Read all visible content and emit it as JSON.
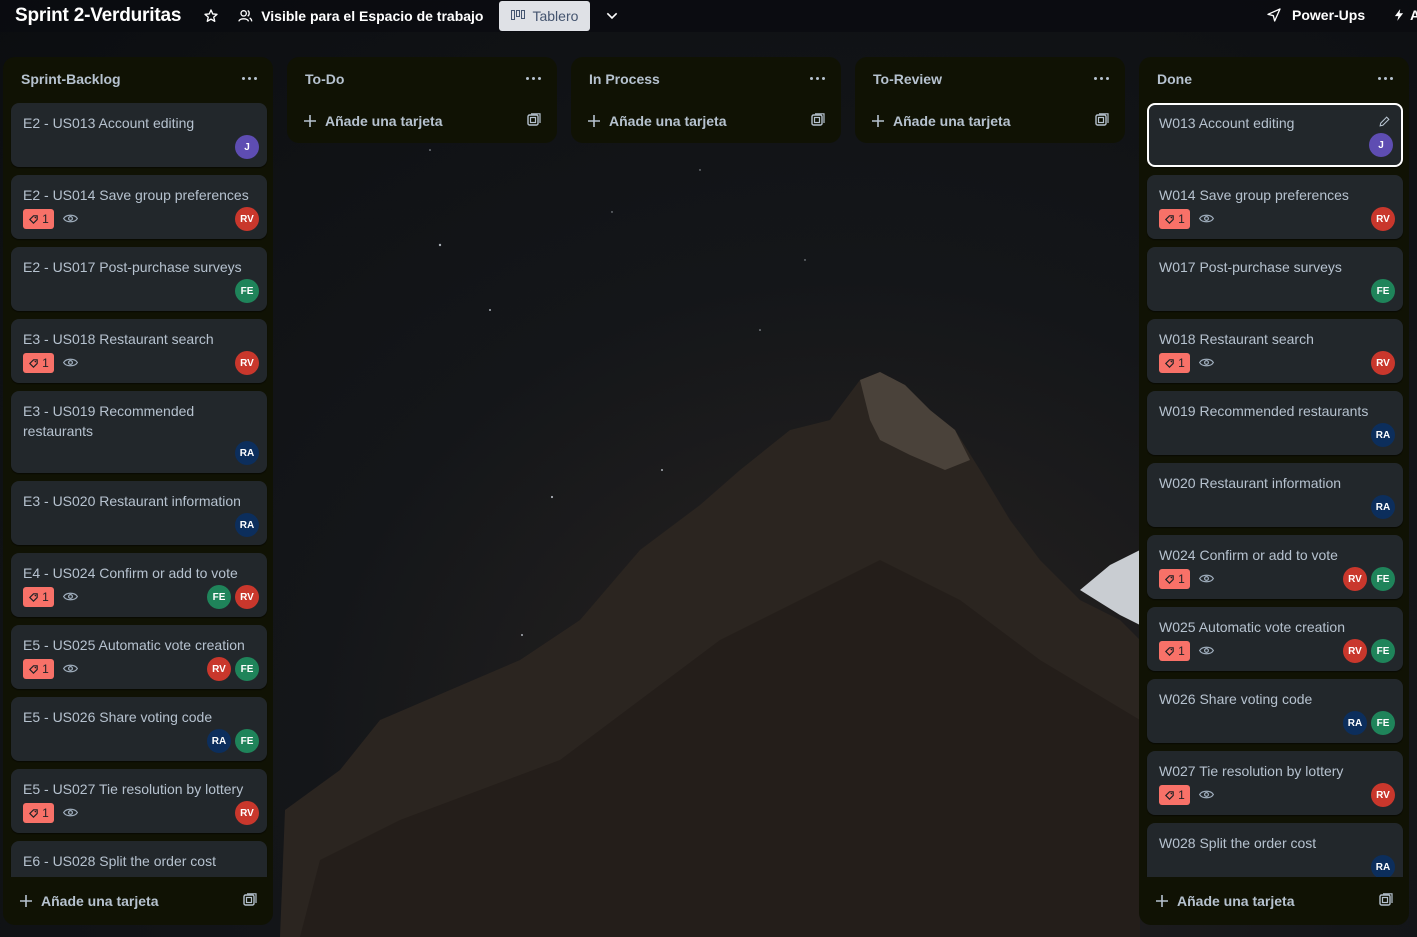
{
  "header": {
    "board_title": "Sprint 2-Verduritas",
    "visibility_label": "Visible para el Espacio de trabajo",
    "view_label": "Tablero",
    "powerups_label": "Power-Ups"
  },
  "add_card_label": "Añade una tarjeta",
  "colors": {
    "list_bg": "#101204",
    "card_bg": "#22272b",
    "text": "#b6c2cf",
    "bug_badge": "#f87168",
    "avatar_J": "#5e4db2",
    "avatar_RV": "#c9372c",
    "avatar_FE": "#1f845a",
    "avatar_RA": "#0c2e5c"
  },
  "icons": {
    "star": "star-icon",
    "visibility": "people-icon",
    "board": "board-icon",
    "chevron": "chevron-down-icon",
    "powerups": "rocket-icon",
    "automation": "lightning-icon",
    "list_menu": "more-horizontal-icon",
    "add": "plus-icon",
    "template": "template-icon",
    "bug": "bug-icon",
    "watch": "eye-icon",
    "edit": "pencil-icon"
  },
  "lists": [
    {
      "title": "Sprint-Backlog",
      "cards": [
        {
          "title": "E2 - US013 Account editing",
          "badge": null,
          "watch": false,
          "avatars": [
            "J"
          ]
        },
        {
          "title": "E2 - US014 Save group preferences",
          "badge": "1",
          "watch": true,
          "avatars": [
            "RV"
          ]
        },
        {
          "title": "E2 - US017 Post-purchase surveys",
          "badge": null,
          "watch": false,
          "avatars": [
            "FE"
          ]
        },
        {
          "title": "E3 - US018 Restaurant search",
          "badge": "1",
          "watch": true,
          "avatars": [
            "RV"
          ]
        },
        {
          "title": "E3 - US019 Recommended restaurants",
          "badge": null,
          "watch": false,
          "avatars": [
            "RA"
          ]
        },
        {
          "title": "E3 - US020 Restaurant information",
          "badge": null,
          "watch": false,
          "avatars": [
            "RA"
          ]
        },
        {
          "title": "E4 - US024 Confirm or add to vote",
          "badge": "1",
          "watch": true,
          "avatars": [
            "FE",
            "RV"
          ]
        },
        {
          "title": "E5 - US025 Automatic vote creation",
          "badge": "1",
          "watch": true,
          "avatars": [
            "RV",
            "FE"
          ]
        },
        {
          "title": "E5 - US026 Share voting code",
          "badge": null,
          "watch": false,
          "avatars": [
            "RA",
            "FE"
          ]
        },
        {
          "title": "E5 - US027 Tie resolution by lottery",
          "badge": "1",
          "watch": true,
          "avatars": [
            "RV"
          ]
        },
        {
          "title": "E6 - US028 Split the order cost",
          "badge": null,
          "watch": false,
          "avatars": []
        }
      ]
    },
    {
      "title": "To-Do",
      "cards": []
    },
    {
      "title": "In Process",
      "cards": []
    },
    {
      "title": "To-Review",
      "cards": []
    },
    {
      "title": "Done",
      "cards": [
        {
          "title": "W013 Account editing",
          "badge": null,
          "watch": false,
          "avatars": [
            "J"
          ],
          "focused": true
        },
        {
          "title": "W014 Save group preferences",
          "badge": "1",
          "watch": true,
          "avatars": [
            "RV"
          ]
        },
        {
          "title": "W017 Post-purchase surveys",
          "badge": null,
          "watch": false,
          "avatars": [
            "FE"
          ]
        },
        {
          "title": "W018 Restaurant search",
          "badge": "1",
          "watch": true,
          "avatars": [
            "RV"
          ]
        },
        {
          "title": "W019 Recommended restaurants",
          "badge": null,
          "watch": false,
          "avatars": [
            "RA"
          ]
        },
        {
          "title": "W020 Restaurant information",
          "badge": null,
          "watch": false,
          "avatars": [
            "RA"
          ]
        },
        {
          "title": "W024 Confirm or add to vote",
          "badge": "1",
          "watch": true,
          "avatars": [
            "RV",
            "FE"
          ]
        },
        {
          "title": "W025 Automatic vote creation",
          "badge": "1",
          "watch": true,
          "avatars": [
            "RV",
            "FE"
          ]
        },
        {
          "title": "W026 Share voting code",
          "badge": null,
          "watch": false,
          "avatars": [
            "RA",
            "FE"
          ]
        },
        {
          "title": "W027 Tie resolution by lottery",
          "badge": "1",
          "watch": true,
          "avatars": [
            "RV"
          ]
        },
        {
          "title": "W028 Split the order cost",
          "badge": null,
          "watch": false,
          "avatars": [
            "RA"
          ]
        }
      ]
    }
  ]
}
